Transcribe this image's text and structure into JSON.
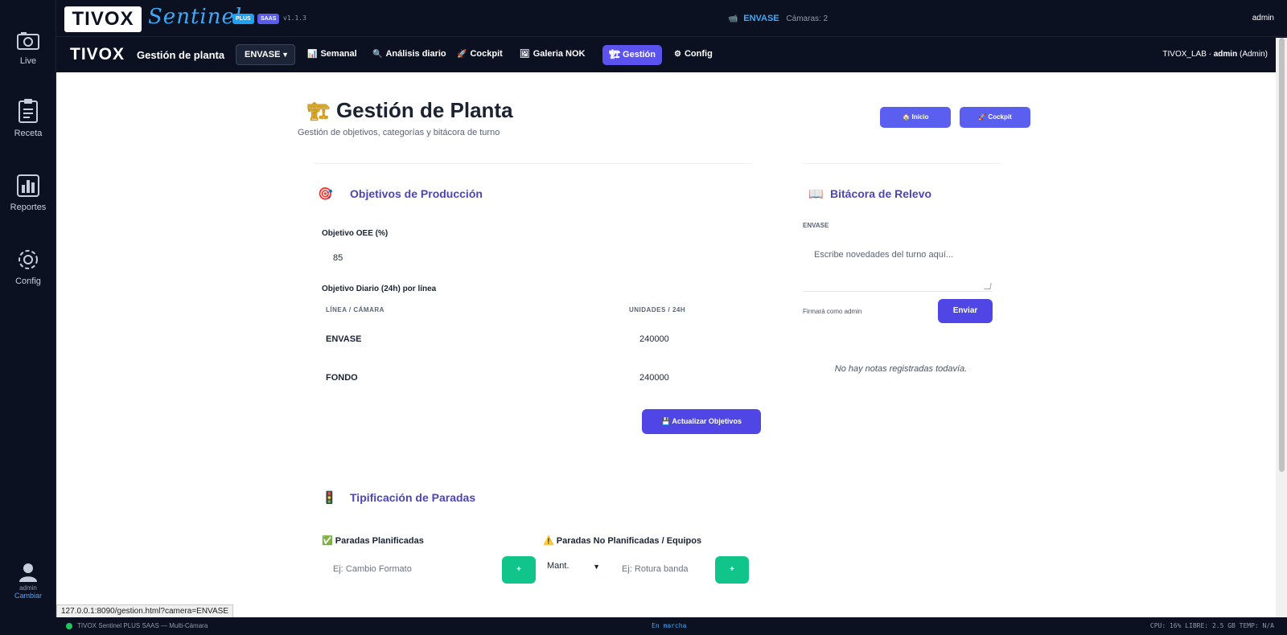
{
  "rail": {
    "items": [
      {
        "label": "Live",
        "icon": "camera-icon"
      },
      {
        "label": "Receta",
        "icon": "clipboard-icon"
      },
      {
        "label": "Reportes",
        "icon": "bar-chart-icon"
      },
      {
        "label": "Config",
        "icon": "gear-icon"
      }
    ],
    "user": {
      "name": "admin",
      "action": "Cambiar"
    }
  },
  "topbar": {
    "logo": "TIVOX",
    "product": "Sentinel",
    "badge_plus": "PLUS",
    "badge_saas": "SAAS",
    "version": "v1.1.3",
    "camera_name": "ENVASE",
    "cameras_label": "Cámaras: 2",
    "user": "admin"
  },
  "navbar": {
    "logo": "TIVOX",
    "title": "Gestión de planta",
    "selected_line": "ENVASE",
    "items": [
      {
        "label": "Semanal",
        "icon": "📊"
      },
      {
        "label": "Análisis diario",
        "icon": "🔍"
      },
      {
        "label": "Cockpit",
        "icon": "🚀"
      },
      {
        "label": "Galeria NOK",
        "icon": "🖼"
      },
      {
        "label": "Gestión",
        "icon": "🏗"
      },
      {
        "label": "Config",
        "icon": "⚙"
      }
    ],
    "org": "TIVOX_LAB ·",
    "user": "admin",
    "role": "(Admin)"
  },
  "page": {
    "title": "Gestión de Planta",
    "subtitle": "Gestión de objetivos, categorías y bitácora de turno",
    "btn_inicio": "🏠 Inicio",
    "btn_cockpit": "🚀 Cockpit"
  },
  "objetivos": {
    "title": "Objetivos de Producción",
    "oee_label": "Objetivo OEE (%)",
    "oee_value": "85",
    "daily_label": "Objetivo Diario (24h) por línea",
    "col_line": "LÍNEA / CÁMARA",
    "col_units": "UNIDADES / 24H",
    "rows": [
      {
        "line": "ENVASE",
        "units": "240000"
      },
      {
        "line": "FONDO",
        "units": "240000"
      }
    ],
    "update_button": "💾 Actualizar Objetivos"
  },
  "bitacora": {
    "title": "Bitácora de Relevo",
    "line": "ENVASE",
    "placeholder": "Escribe novedades del turno aquí...",
    "sign_as": "Firmará como admin",
    "send_button": "Enviar",
    "empty": "No hay notas registradas todavía."
  },
  "paradas": {
    "title": "Tipificación de Paradas",
    "planned_label": "Paradas Planificadas",
    "planned_placeholder": "Ej: Cambio Formato",
    "unplanned_label": "Paradas No Planificadas / Equipos",
    "unplanned_select": "Mant.",
    "unplanned_placeholder": "Ej: Rotura banda",
    "add_button": "+"
  },
  "statusbar": {
    "app": "TIVOX Sentinel PLUS SAAS — Multi-Cámara",
    "status": "En marcha",
    "metrics": "CPU: 16%  LIBRE: 2.5 GB  TEMP: N/A"
  },
  "url_tooltip": "127.0.0.1:8090/gestion.html?camera=ENVASE",
  "colors": {
    "accent": "#4f46e5",
    "nav_active": "#5b52f0",
    "success": "#10c48a",
    "brand_blue": "#3fa9f5",
    "section_title": "#4c45b8",
    "dark_bg": "#0b1120"
  }
}
